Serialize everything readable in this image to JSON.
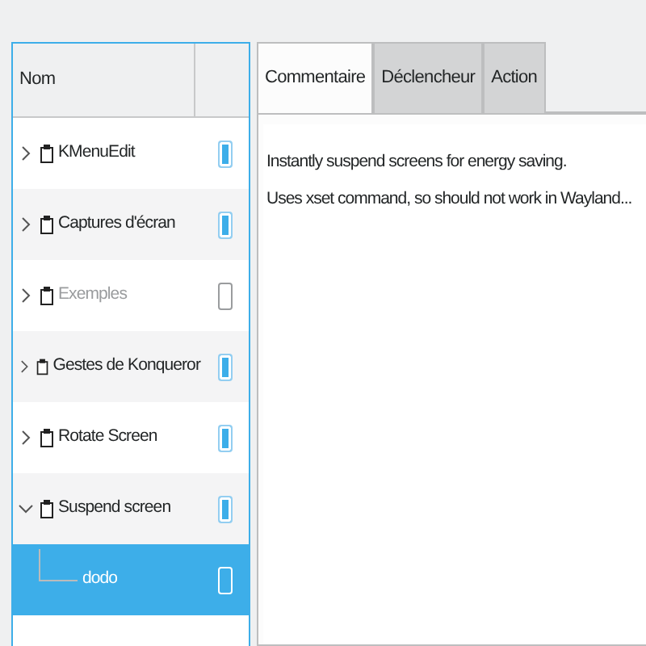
{
  "tree": {
    "header": "Nom",
    "items": [
      {
        "label": "KMenuEdit",
        "enabled": true,
        "expanded": false,
        "selected": false
      },
      {
        "label": "Captures d'écran",
        "enabled": true,
        "expanded": false,
        "selected": false
      },
      {
        "label": "Exemples",
        "enabled": false,
        "expanded": false,
        "selected": false
      },
      {
        "label": "Gestes de Konqueror",
        "enabled": true,
        "expanded": false,
        "selected": false
      },
      {
        "label": "Rotate Screen",
        "enabled": true,
        "expanded": false,
        "selected": false
      },
      {
        "label": "Suspend screen",
        "enabled": true,
        "expanded": true,
        "selected": false,
        "children": [
          {
            "label": "dodo",
            "enabled": true,
            "selected": true
          }
        ]
      }
    ]
  },
  "tabs": [
    {
      "label": "Commentaire",
      "selected": true
    },
    {
      "label": "Déclencheur",
      "selected": false
    },
    {
      "label": "Action",
      "selected": false
    }
  ],
  "comment": [
    "Instantly suspend screens for energy saving.",
    "Uses xset command, so should not work in Wayland..."
  ]
}
